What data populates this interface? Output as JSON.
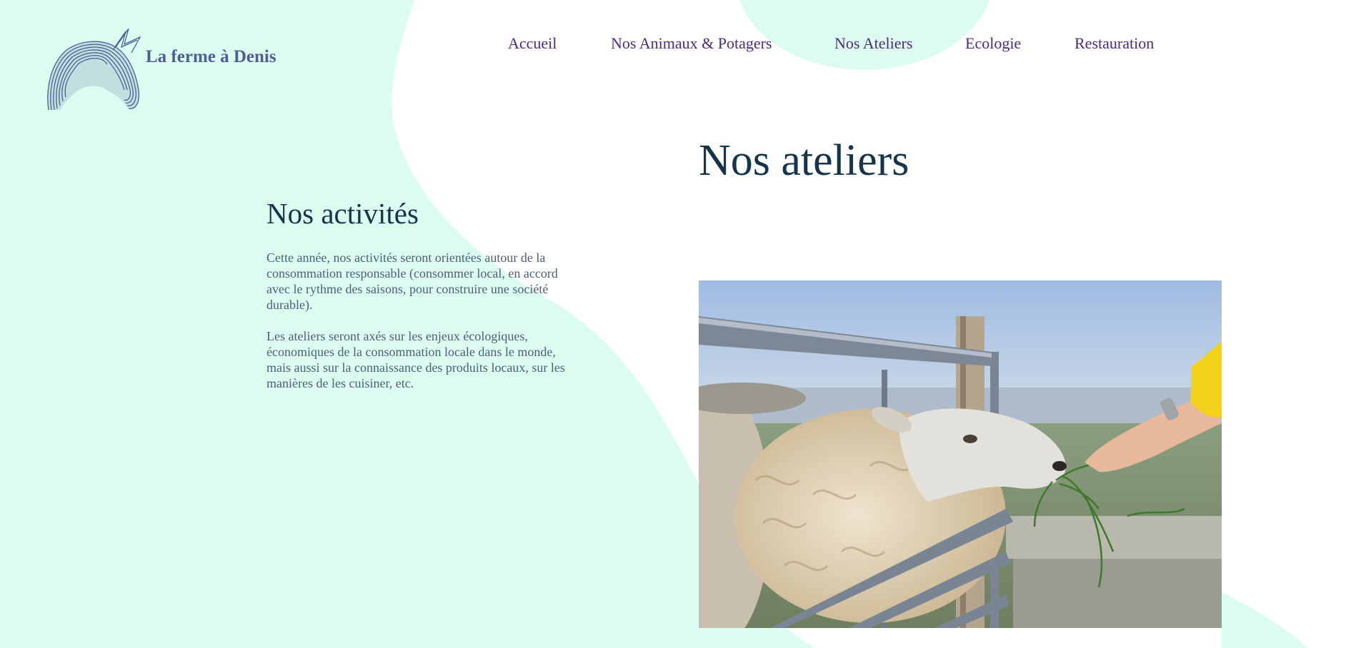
{
  "site": {
    "title": "La ferme à Denis"
  },
  "nav": {
    "items": [
      {
        "label": "Accueil"
      },
      {
        "label": "Nos Animaux & Potagers"
      },
      {
        "label": "Nos Ateliers"
      },
      {
        "label": "Ecologie"
      },
      {
        "label": "Restauration"
      }
    ]
  },
  "main": {
    "page_title": "Nos ateliers",
    "section_title": "Nos activités",
    "paragraphs": [
      "Cette année, nos activités seront orientées autour de la consommation responsable (consommer local, en accord avec le rythme des saisons, pour construire une société durable).",
      "Les ateliers seront axés sur les enjeux écologiques, économiques de la consommation locale dans le monde, mais aussi sur la connaissance des produits locaux, sur les manières de les cuisiner, etc."
    ]
  },
  "colors": {
    "mint_background": "#dcfcf0",
    "nav_link": "#4b2b86",
    "heading": "#14354b",
    "body_text": "#4d5f75",
    "logo": "#4d5f95"
  },
  "icons": {
    "logo": "horse-head-logo-icon"
  }
}
